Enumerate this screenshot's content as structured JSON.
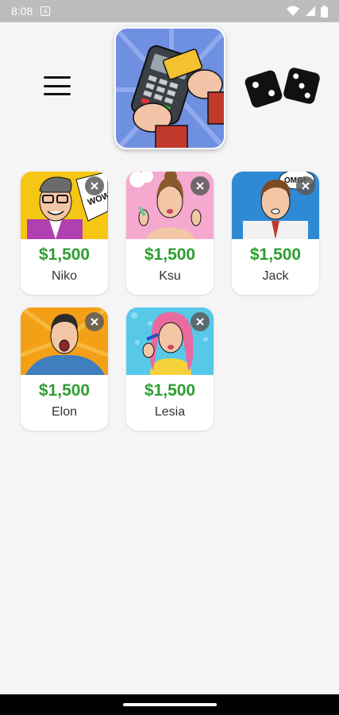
{
  "status_bar": {
    "time": "8:08",
    "icons": [
      "notification-a-icon",
      "wifi-icon",
      "signal-icon",
      "battery-icon"
    ]
  },
  "header": {
    "menu_icon": "hamburger-menu-icon",
    "hero_image": "card-payment-terminal-illustration",
    "dice_icon": "dice-icon"
  },
  "cards": [
    {
      "name": "Niko",
      "price": "$1,500",
      "image": "niko-portrait"
    },
    {
      "name": "Ksu",
      "price": "$1,500",
      "image": "ksu-portrait"
    },
    {
      "name": "Jack",
      "price": "$1,500",
      "image": "jack-portrait"
    },
    {
      "name": "Elon",
      "price": "$1,500",
      "image": "elon-portrait"
    },
    {
      "name": "Lesia",
      "price": "$1,500",
      "image": "lesia-portrait"
    }
  ],
  "colors": {
    "price_green": "#2e9e33",
    "background": "#f5f5f5",
    "status_bar": "#bdbdbd"
  }
}
